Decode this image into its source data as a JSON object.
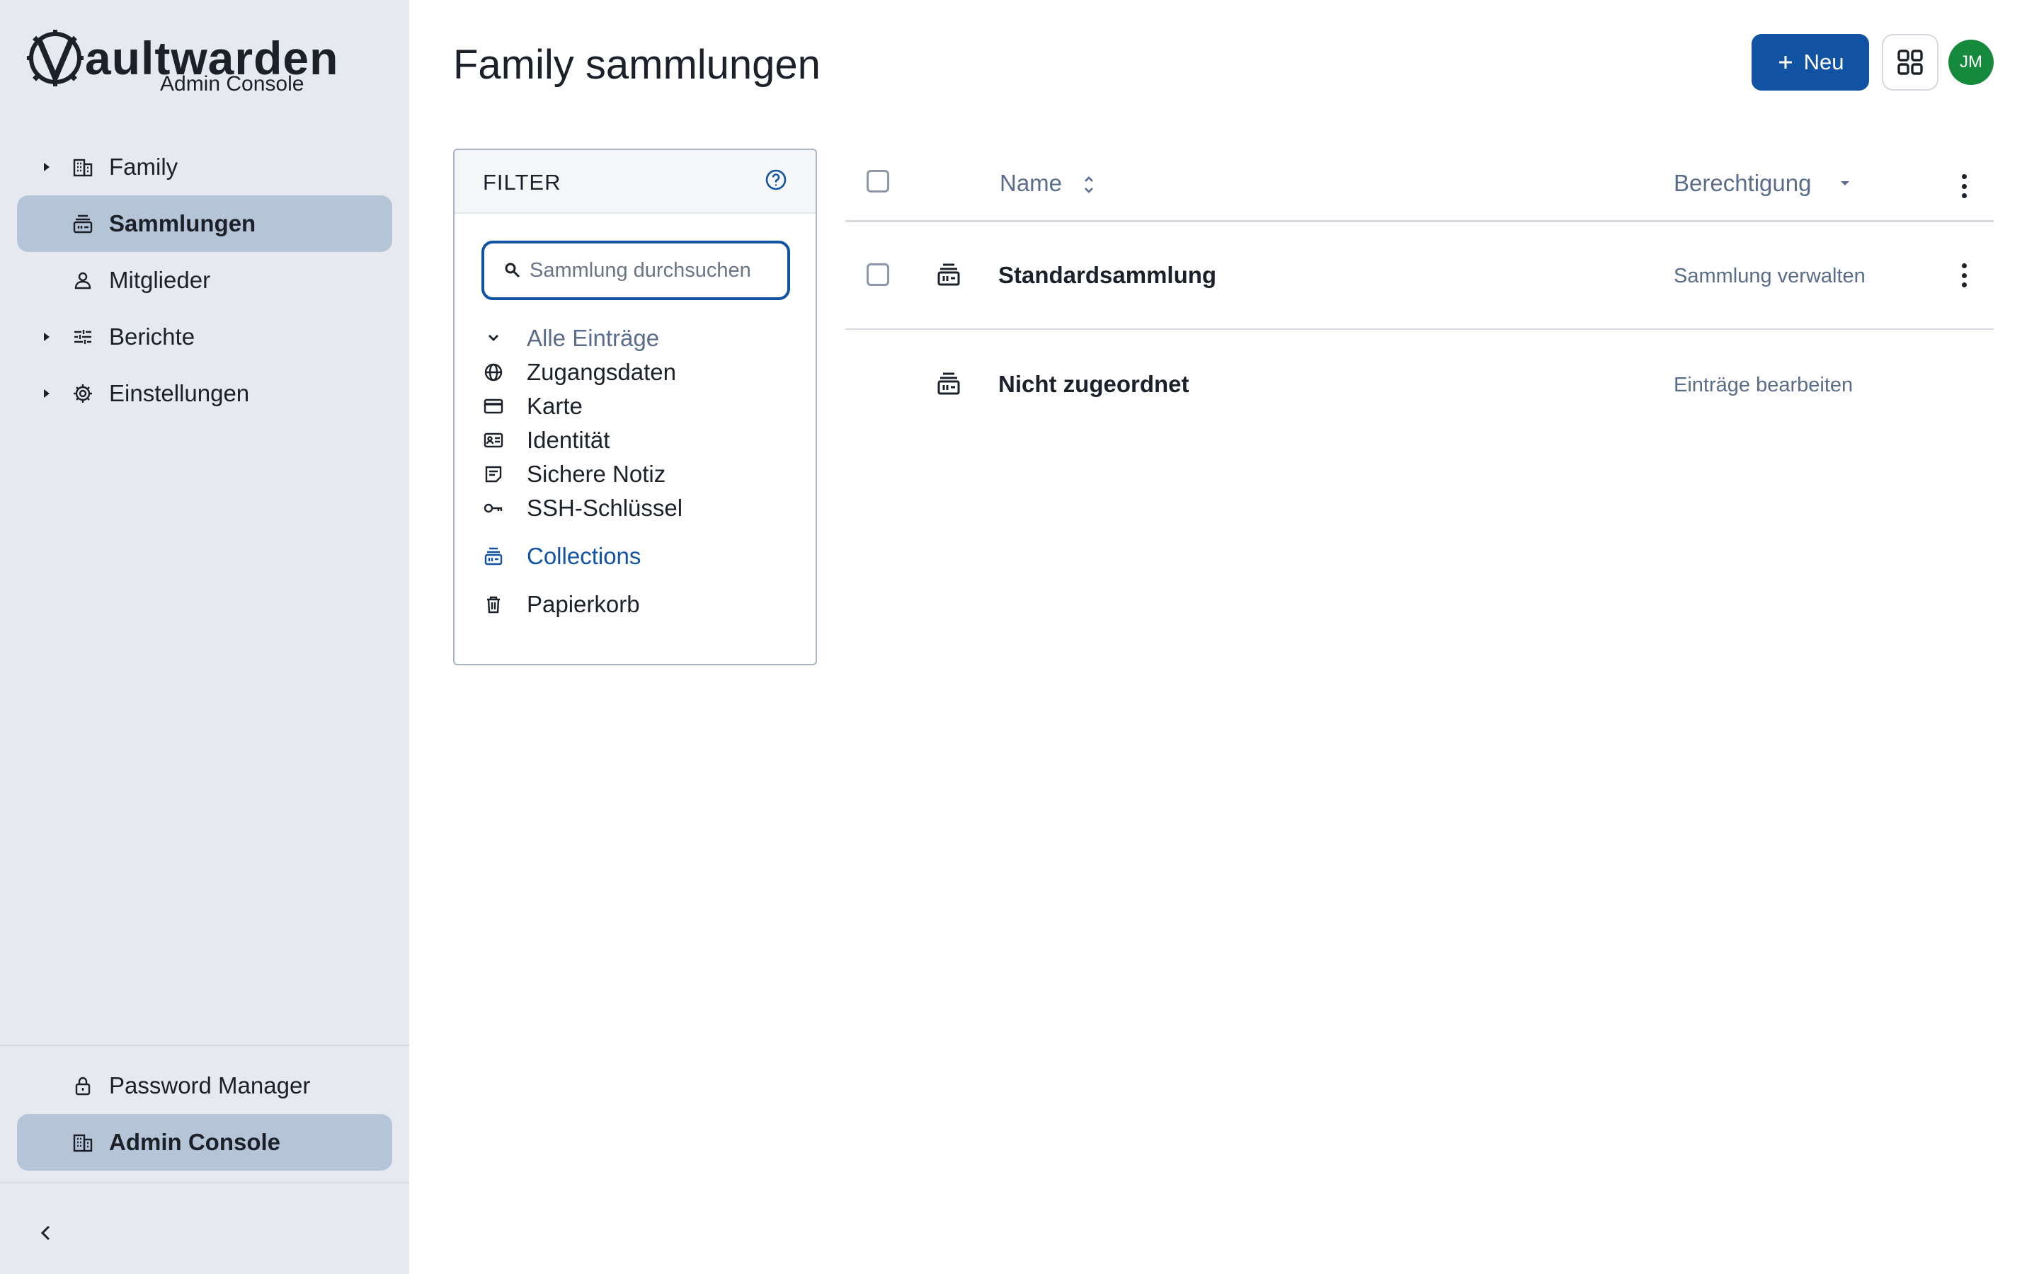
{
  "app": {
    "logo_text_bold": "V",
    "logo_text_rest": "aultwarden",
    "logo_subtitle": "Admin Console"
  },
  "sidebar": {
    "items": [
      {
        "label": "Family",
        "icon": "building-icon",
        "expandable": true,
        "active": false
      },
      {
        "label": "Sammlungen",
        "icon": "collection-icon",
        "expandable": false,
        "active": true
      },
      {
        "label": "Mitglieder",
        "icon": "user-icon",
        "expandable": false,
        "active": false
      },
      {
        "label": "Berichte",
        "icon": "sliders-icon",
        "expandable": true,
        "active": false
      },
      {
        "label": "Einstellungen",
        "icon": "gear-icon",
        "expandable": true,
        "active": false
      }
    ],
    "product_switcher": [
      {
        "label": "Password Manager",
        "icon": "lock-icon",
        "active": false
      },
      {
        "label": "Admin Console",
        "icon": "building-icon",
        "active": true
      }
    ]
  },
  "header": {
    "title": "Family sammlungen",
    "new_button_label": "Neu",
    "avatar_initials": "JM"
  },
  "filter": {
    "title": "FILTER",
    "search_placeholder": "Sammlung durchsuchen",
    "search_value": "",
    "all_items_label": "Alle Einträge",
    "types": [
      {
        "label": "Zugangsdaten",
        "icon": "globe-icon"
      },
      {
        "label": "Karte",
        "icon": "card-icon"
      },
      {
        "label": "Identität",
        "icon": "id-card-icon"
      },
      {
        "label": "Sichere Notiz",
        "icon": "note-icon"
      },
      {
        "label": "SSH-Schlüssel",
        "icon": "key-icon"
      }
    ],
    "collections_label": "Collections",
    "trash_label": "Papierkorb"
  },
  "table": {
    "columns": {
      "name": "Name",
      "permission": "Berechtigung"
    },
    "rows": [
      {
        "name": "Standardsammlung",
        "permission": "Sammlung verwalten",
        "selectable": true
      },
      {
        "name": "Nicht zugeordnet",
        "permission": "Einträge bearbeiten",
        "selectable": false
      }
    ]
  },
  "colors": {
    "primary": "#1252a3",
    "sidebar_bg": "#e6e9ef",
    "sidebar_active": "#b6c4d8",
    "avatar": "#158a3c",
    "muted_text": "#5a6c8a"
  }
}
